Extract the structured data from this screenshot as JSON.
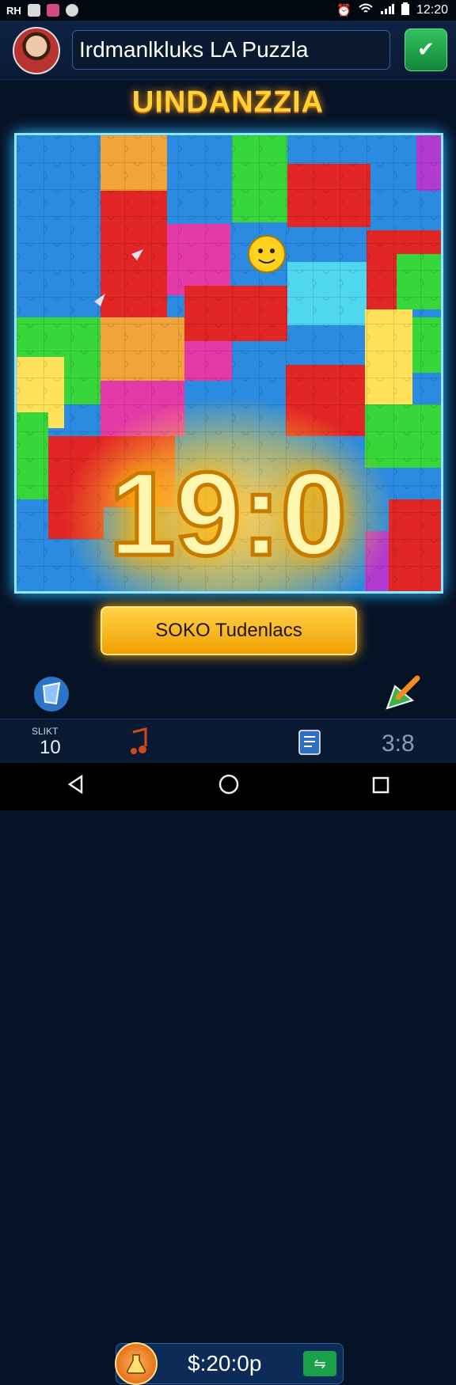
{
  "status_bar": {
    "left_text": "RH",
    "time": "12:20",
    "icons": [
      "photo-icon",
      "app-icon",
      "chat-icon",
      "alarm-icon",
      "wifi-icon",
      "signal-icon",
      "battery-icon"
    ]
  },
  "header": {
    "title": "Irdmanlkluks LA Puzzla",
    "check_icon": "✔"
  },
  "game_title": "UINDANZZIA",
  "score": "19:0",
  "action_button": "SOKO Tudenlacs",
  "tools": {
    "left_icon": "bucket-icon",
    "right_icon": "pencil-arrow-icon"
  },
  "coin_bar": {
    "value": "$:20:0p",
    "button_glyph": "⇋"
  },
  "bottom_stats": {
    "label": "SLIKT",
    "value": "10",
    "right_value": "3:8"
  },
  "colors": {
    "board_blue": "#2a8be0",
    "red": "#e22525",
    "green": "#37d63a",
    "yellow": "#ffe25a",
    "magenta": "#e43aa8",
    "cyan": "#4fd7f0",
    "score_glow": "#ffb400",
    "button_gold": "#f0a000"
  }
}
